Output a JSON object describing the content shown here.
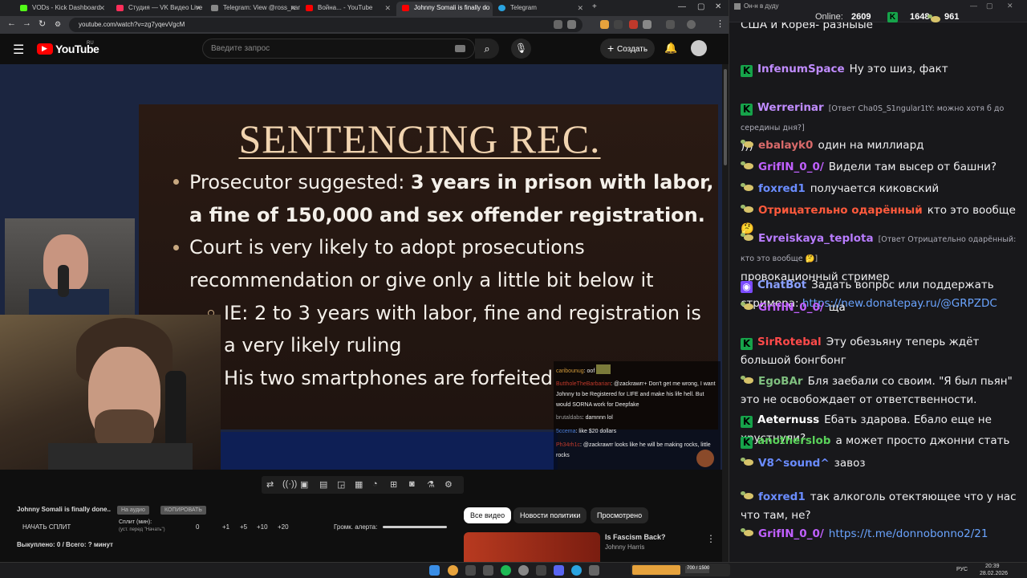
{
  "browser": {
    "tabs": [
      {
        "label": "VODs - Kick Dashboard",
        "color": "#53fc18"
      },
      {
        "label": "Студия — VK Видео Live",
        "color": "#ff2e5a"
      },
      {
        "label": "Telegram: View @ross_name",
        "color": "#888888"
      },
      {
        "label": "Война... - YouTube",
        "color": "#ff0000"
      },
      {
        "label": "Johnny Somali is finally do",
        "color": "#ff0000"
      },
      {
        "label": "Telegram",
        "color": "#2aa3e0"
      }
    ],
    "url": "youtube.com/watch?v=zg7yqevVgcM"
  },
  "youtube": {
    "logo": "YouTube",
    "region": "RU",
    "search_placeholder": "Введите запрос",
    "create_label": "Создать"
  },
  "slide": {
    "title": "SENTENCING REC.",
    "line1a": "Prosecutor suggested: ",
    "line1b": "3 years in prison with labor,",
    "line2": "a fine of 150,000 and sex offender registration.",
    "line3": "Court is very likely to adopt prosecutions",
    "line4": "recommendation or give only a little bit below it",
    "line5": "IE: 2 to 3 years with labor, fine and registration is",
    "line6": "a very likely ruling",
    "line7": "His two smartphones are forfeited"
  },
  "video_chat": [
    {
      "user": "caribounug",
      "text": "oof"
    },
    {
      "user": "ButtholeTheBarbarian",
      "text": "@zackrawrr+ Don't get me wrong, I want Johnny to be Registered for LIFE and make his life hell. But would SORNA work for Deepfake"
    },
    {
      "user": "brutaldabs",
      "text": "damnnn lol"
    },
    {
      "user": "5ccema",
      "text": "like $20 dollars"
    },
    {
      "user": "Ph34rh1c",
      "text": "@zackrawrr looks like he will be making rocks, little rocks"
    }
  ],
  "below": {
    "video_title": "Johnny Somali is finally done..",
    "btn_audio": "На аудио",
    "btn_copy": "КОПИРОВАТЬ",
    "start_split": "НАЧАТЬ СПЛИТ",
    "split_min": "Сплит (мин):",
    "split_hint": "(уст. перед \"Начать\")",
    "split_zero": "0",
    "plus1": "+1",
    "plus5": "+5",
    "plus10": "+10",
    "plus20": "+20",
    "alert_volume": "Громк. алерта:",
    "bought": "Выкуплено: 0 / Всего: ? минут",
    "chip_all": "Все видео",
    "chip_news": "Новости политики",
    "chip_watched": "Просмотрено",
    "rec_title": "Is Fascism Back?",
    "rec_channel": "Johnny Harris"
  },
  "chat": {
    "header": "Он-н в дуду",
    "online_label": "Online:",
    "online": "2609",
    "kick_count": "1648",
    "vk_count": "961",
    "top_fragment": "США и Корея- разныые",
    "messages": [
      {
        "badge": "kick",
        "user": "InfenumSpace",
        "color": "#c08cff",
        "text": "Ну это шиз, факт"
      },
      {
        "badge": "kick",
        "user": "Werrerinar",
        "color": "#c08cff",
        "reply": "[Ответ Cha0S_S1ngular1tY: можно хотя б до середины дня?]",
        "text": ")))"
      },
      {
        "badge": "vk",
        "user": "ebalayk0",
        "color": "#d96a6a",
        "text": "один на миллиард"
      },
      {
        "badge": "vk",
        "user": "GrifIN_0_0/",
        "color": "#c060ff",
        "text": "Видели там высер от башни?"
      },
      {
        "badge": "vk",
        "user": "foxred1",
        "color": "#6a8cff",
        "text": "получается киковский"
      },
      {
        "badge": "vk",
        "user": "Отрицательно одарённый",
        "color": "#ff5a3c",
        "text": "кто это вообще 🤔"
      },
      {
        "badge": "vk",
        "user": "Evreiskaya_teplota",
        "color": "#b87cff",
        "reply": "[Ответ Отрицательно одарённый: кто это вообще 🤔]",
        "text": "провокационный стример"
      },
      {
        "badge": "bot",
        "user": "ChatBot",
        "color": "#8aa0ff",
        "text": "Задать вопрос или поддержать стримера: ",
        "link": "https://new.donatepay.ru/@GRPZDC"
      },
      {
        "badge": "vk",
        "user": "GrifIN_0_0/",
        "color": "#c060ff",
        "text": "ща"
      },
      {
        "badge": "kick",
        "user": "SirRotebal",
        "color": "#ff4a4a",
        "text": "Эту обезьяну теперь ждёт большой бонгбонг"
      },
      {
        "badge": "vk",
        "user": "EgoBAr",
        "color": "#7fbf7f",
        "text": "Бля заебали со своим. \"Я был пьян\" это не освобождает от ответственности."
      },
      {
        "badge": "kick",
        "user": "Aeternuss",
        "color": "#ffffff",
        "text": "Ебать здарова. Ебало еще не хрустнули?"
      },
      {
        "badge": "kick",
        "user": "anotherslob",
        "color": "#5ad15a",
        "text": "а может просто джонни стать"
      },
      {
        "badge": "vk",
        "user": "V8^sound^",
        "color": "#6a8cff",
        "text": "завоз"
      },
      {
        "badge": "vk",
        "user": "foxred1",
        "color": "#6a8cff",
        "text": "так алкоголь отектяющее что у нас что там, не?"
      },
      {
        "badge": "vk",
        "user": "GrifIN_0_0/",
        "color": "#c060ff",
        "text": "",
        "link": "https://t.me/donnobonno2/21"
      }
    ]
  },
  "taskbar": {
    "lang": "РУС",
    "time": "20:39",
    "date": "28.02.2026",
    "widget": "700 / 1500"
  }
}
